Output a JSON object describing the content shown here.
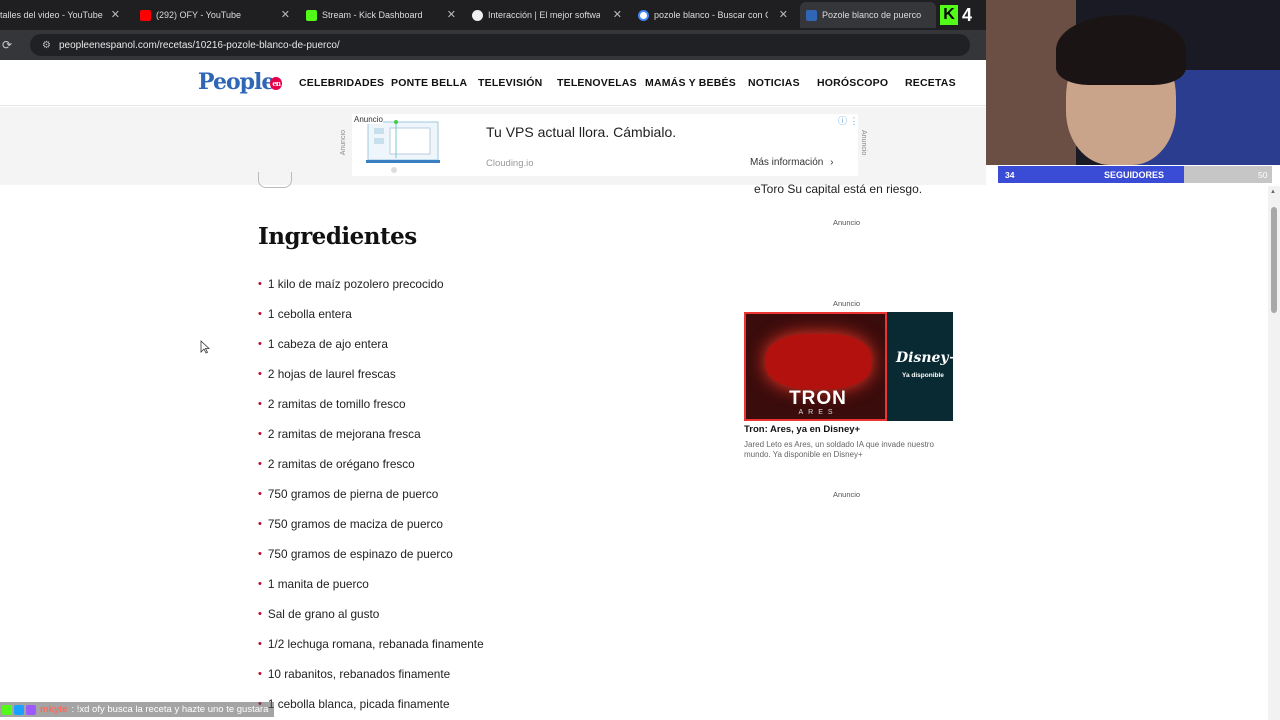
{
  "browser": {
    "tabs": [
      {
        "title": "talles del video - YouTube St",
        "color": "#c00"
      },
      {
        "title": "(292) OFY - YouTube",
        "color": "#f00"
      },
      {
        "title": "Stream - Kick Dashboard",
        "color": "#53fc18"
      },
      {
        "title": "Interacción | El mejor software",
        "color": "#fff"
      },
      {
        "title": "pozole blanco - Buscar con Go",
        "color": "#4285f4"
      },
      {
        "title": "Pozole blanco de puerco",
        "color": "#2f66b5"
      }
    ],
    "url": "peopleenespanol.com/recetas/10216-pozole-blanco-de-puerco/",
    "kick_badge": "4"
  },
  "site": {
    "logo": "People",
    "logo_badge": "en",
    "nav": [
      "CELEBRIDADES",
      "PONTE BELLA",
      "TELEVISIÓN",
      "TELENOVELAS",
      "MAMÁS Y BEBÉS",
      "NOTICIAS",
      "HORÓSCOPO",
      "RECETAS"
    ]
  },
  "top_ad": {
    "side_label_left": "Anuncio",
    "side_label_right": "Anuncio",
    "tag": "Anuncio",
    "headline": "Tu VPS actual llora. Cámbialo.",
    "source": "Clouding.io",
    "cta": "Más información",
    "cta_icon": "chevron-right-icon"
  },
  "main": {
    "heading": "Ingredientes",
    "ingredients": [
      "1 kilo de maíz pozolero precocido",
      "1 cebolla entera",
      "1 cabeza de ajo entera",
      "2 hojas de laurel frescas",
      "2 ramitas de tomillo fresco",
      "2 ramitas de mejorana fresca",
      "2 ramitas de orégano fresco",
      "750 gramos de pierna de puerco",
      "750 gramos de maciza de puerco",
      "750 gramos de espinazo de puerco",
      "1 manita de puerco",
      "Sal de grano al gusto",
      "1/2 lechuga romana, rebanada finamente",
      "10 rabanitos, rebanados finamente",
      "1 cebolla blanca, picada finamente"
    ],
    "bullet_color": "#c4002c"
  },
  "sidebar": {
    "etoro_text": "eToro Su capital está en riesgo.",
    "anuncio_1": "Anuncio",
    "anuncio_2": "Anuncio",
    "anuncio_3": "Anuncio",
    "promo": {
      "tron": "TRON",
      "ares": "ARES",
      "brand": "Disney+",
      "brand_sub": "Ya disponible",
      "title": "Tron: Ares, ya en Disney+",
      "description": "Jared Leto es Ares, un soldado IA que invade nuestro mundo. Ya disponible en Disney+"
    }
  },
  "stream_overlay": {
    "followers_current": "34",
    "followers_label": "SEGUIDORES",
    "followers_goal": "50",
    "followers_progress": 0.68,
    "chat_user": "mkyte",
    "chat_message": ": !xd ofy busca la receta y hazte uno te gustara"
  }
}
